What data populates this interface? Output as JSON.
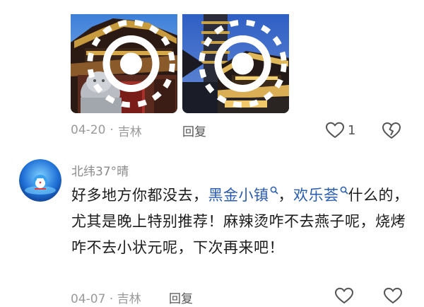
{
  "post1": {
    "date": "04-20",
    "separator": "·",
    "location": "吉林",
    "reply_label": "回复",
    "like_count": "1"
  },
  "comment": {
    "username": "北纬37°晴",
    "text_before": "好多地方你都没去，",
    "tag1": "黑金小镇",
    "text_mid": "，",
    "tag2": "欢乐荟",
    "text_after": "什么的，尤其是晚上特别推荐！麻辣烫咋不去燕子呢，烧烤咋不去小状元呢，下次再来吧！",
    "date": "04-07",
    "separator": "·",
    "location": "吉林",
    "reply_label": "回复"
  },
  "icons": {
    "like": "heart-outline-icon",
    "dislike": "broken-heart-icon",
    "search": "search-icon",
    "live": "live-photo-icon"
  },
  "colors": {
    "tag_link": "#2a5db0",
    "meta_text": "#9a9a9a"
  }
}
